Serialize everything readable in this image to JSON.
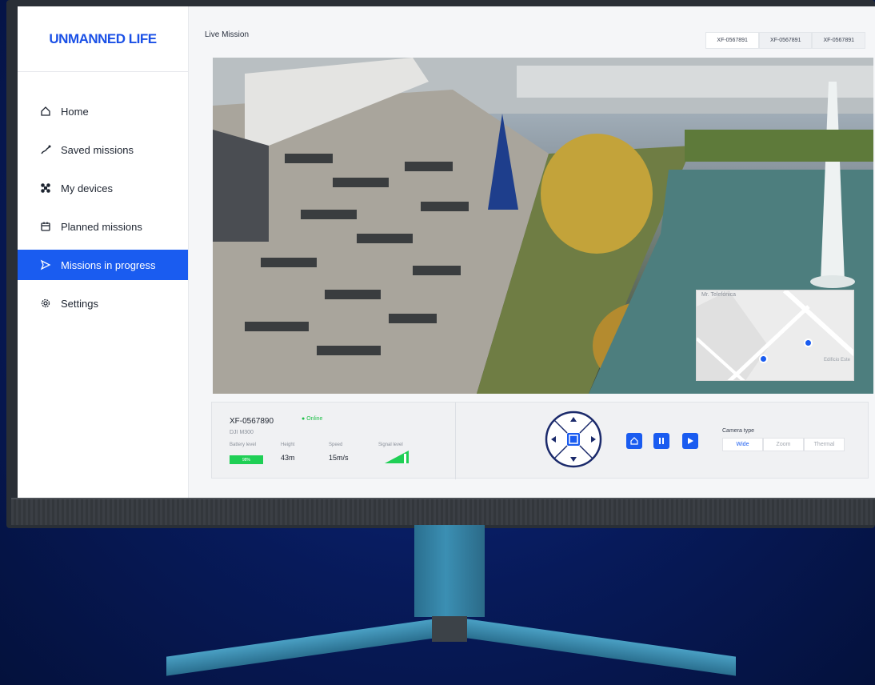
{
  "app": {
    "logo": "UNMANNED LIFE"
  },
  "sidebar": {
    "items": [
      {
        "label": "Home",
        "icon": "home-icon",
        "active": false
      },
      {
        "label": "Saved missions",
        "icon": "route-icon",
        "active": false
      },
      {
        "label": "My devices",
        "icon": "drone-icon",
        "active": false
      },
      {
        "label": "Planned missions",
        "icon": "calendar-icon",
        "active": false
      },
      {
        "label": "Missions in progress",
        "icon": "send-icon",
        "active": true
      },
      {
        "label": "Settings",
        "icon": "gear-icon",
        "active": false
      }
    ]
  },
  "main": {
    "title": "Live Mission",
    "tabs": [
      {
        "label": "XF-0567891",
        "active": true
      },
      {
        "label": "XF-0567891",
        "active": false
      },
      {
        "label": "XF-0567891",
        "active": false
      }
    ],
    "map": {
      "label": "Mr. Telefónica",
      "label2": "Edificio Este"
    }
  },
  "device": {
    "id": "XF-0567890",
    "status": "Online",
    "model": "DJI M300",
    "battery_label": "Battery level",
    "battery_value": "98%",
    "battery_fraction": 0.98,
    "height_label": "Height",
    "height_value": "43m",
    "speed_label": "Speed",
    "speed_value": "15m/s",
    "signal_label": "Signal level",
    "signal_fraction": 0.9
  },
  "camera": {
    "label": "Camera type",
    "options": [
      {
        "label": "Wide",
        "active": true
      },
      {
        "label": "Zoom",
        "active": false
      },
      {
        "label": "Thermal",
        "active": false
      }
    ]
  },
  "colors": {
    "accent": "#1a5cf0",
    "online": "#20c04a",
    "battery": "#1fcf55"
  }
}
